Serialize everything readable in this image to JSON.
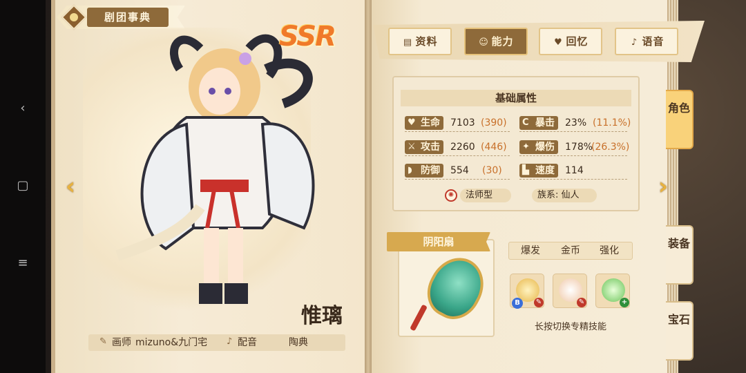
{
  "header": {
    "title": "剧团事典"
  },
  "character": {
    "rarity": "SSR",
    "name": "惟璃",
    "artist_label": "画师",
    "artist": "mizuno&九门宅",
    "voice_label": "配音",
    "voice_actor": "陶典"
  },
  "tabs": [
    {
      "label": "资料",
      "icon": "book-icon"
    },
    {
      "label": "能力",
      "icon": "face-icon"
    },
    {
      "label": "回忆",
      "icon": "heart-icon"
    },
    {
      "label": "语音",
      "icon": "microphone-icon"
    }
  ],
  "active_tab": "能力",
  "side_tabs": [
    "角色",
    "装备",
    "宝石"
  ],
  "stats": {
    "title": "基础属性",
    "hp": {
      "label": "生命",
      "value": "7103",
      "bonus": "(390)"
    },
    "crit": {
      "label": "暴击",
      "value": "23%",
      "bonus": "(11.1%)"
    },
    "atk": {
      "label": "攻击",
      "value": "2260",
      "bonus": "(446)"
    },
    "crit_dmg": {
      "label": "爆伤",
      "value": "178%",
      "bonus": "(26.3%)"
    },
    "def": {
      "label": "防御",
      "value": "554",
      "bonus": "(30)"
    },
    "speed": {
      "label": "速度",
      "value": "114"
    },
    "class": "法师型",
    "race": "族系: 仙人"
  },
  "weapon": {
    "name": "阴阳扇",
    "skill_tabs": [
      "爆发",
      "金币",
      "强化"
    ],
    "skill_badges": [
      "B"
    ],
    "hint": "长按切换专精技能"
  },
  "colors": {
    "accent": "#8e6a3a",
    "ssr": "#f07a2a",
    "bonus": "#c8702a"
  }
}
